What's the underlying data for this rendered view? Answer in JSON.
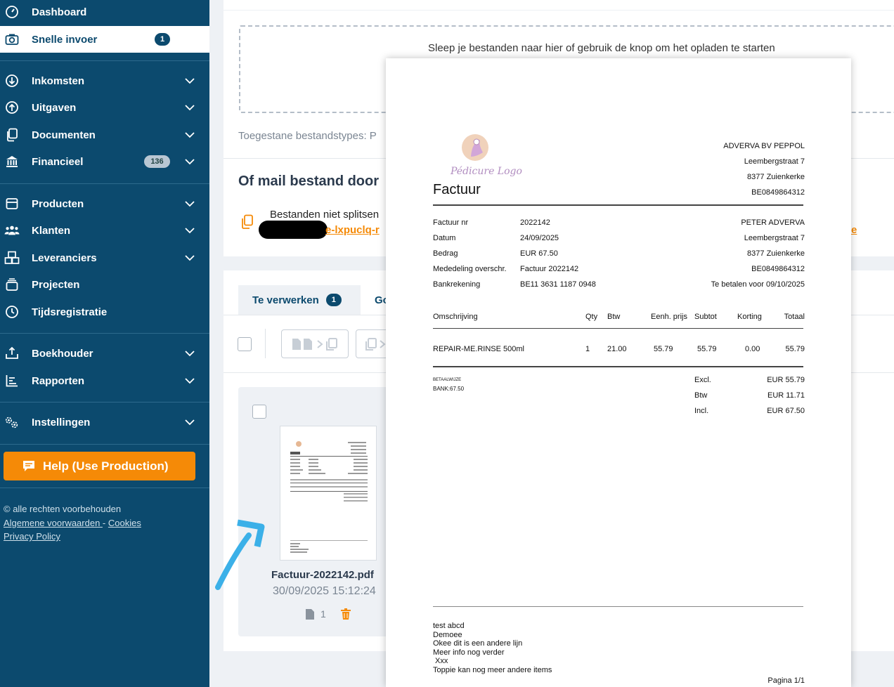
{
  "sidebar": {
    "items": [
      {
        "label": "Dashboard",
        "icon": "dashboard-icon"
      },
      {
        "label": "Snelle invoer",
        "icon": "camera-icon",
        "badge": "1"
      },
      {
        "label": "Inkomsten",
        "icon": "arrow-down-circle-icon"
      },
      {
        "label": "Uitgaven",
        "icon": "arrow-up-circle-icon"
      },
      {
        "label": "Documenten",
        "icon": "documents-icon"
      },
      {
        "label": "Financieel",
        "icon": "bank-icon",
        "badge": "136"
      },
      {
        "label": "Producten",
        "icon": "box-icon"
      },
      {
        "label": "Klanten",
        "icon": "users-icon"
      },
      {
        "label": "Leveranciers",
        "icon": "boxes-icon"
      },
      {
        "label": "Projecten",
        "icon": "stack-icon"
      },
      {
        "label": "Tijdsregistratie",
        "icon": "clock-icon"
      },
      {
        "label": "Boekhouder",
        "icon": "upload-tray-icon"
      },
      {
        "label": "Rapporten",
        "icon": "chart-icon"
      },
      {
        "label": "Instellingen",
        "icon": "gears-icon"
      }
    ],
    "help_label": "Help (Use Production)",
    "copyright": "© alle rechten voorbehouden",
    "links": {
      "terms": "Algemene voorwaarden ",
      "dash": "-",
      "cookies": "Cookies",
      "privacy": "Privacy Policy"
    }
  },
  "upload": {
    "drop_text": "Sleep je bestanden naar hier of gebruik de knop om het opladen te starten",
    "allowed_label": "Toegestane bestandstypes: P",
    "mail_title": "Of mail bestand door",
    "no_split": "Bestanden niet splitsen",
    "mail_fragment": "e-lxpuclq-r",
    "right_fragment": "e"
  },
  "tabs": {
    "to_process": "Te verwerken",
    "to_process_count": "1",
    "other": "Go"
  },
  "file": {
    "name": "Factuur-2022142.pdf",
    "date": "30/09/2025 15:12:24",
    "pages": "1"
  },
  "invoice": {
    "logo_text": "Pédicure Logo",
    "title": "Factuur",
    "seller": [
      "ADVERVA BV PEPPOL",
      "Leembergstraat 7",
      "8377 Zuienkerke",
      "BE0849864312"
    ],
    "meta_labels": [
      "Factuur nr",
      "Datum",
      "Bedrag",
      "Mededeling overschr.",
      "Bankrekening"
    ],
    "meta_values": [
      "2022142",
      "24/09/2025",
      "EUR 67.50",
      "Factuur 2022142",
      "BE11 3631 1187 0948"
    ],
    "buyer": [
      "PETER ADVERVA",
      "Leembergstraat 7",
      "8377 Zuienkerke",
      "BE0849864312",
      "Te betalen voor 09/10/2025"
    ],
    "columns": [
      "Omschrijving",
      "Qty",
      "Btw",
      "Eenh. prijs",
      "Subtot",
      "Korting",
      "Totaal"
    ],
    "line": [
      "REPAIR-ME.RINSE 500ml",
      "1",
      "21.00",
      "55.79",
      "55.79",
      "0.00",
      "55.79"
    ],
    "payment_note": [
      "BETAALWIJZE",
      "BANK:67.50"
    ],
    "totals_labels": [
      "Excl.",
      "Btw",
      "Incl."
    ],
    "totals_values": [
      "EUR 55.79",
      "EUR 11.71",
      "EUR 67.50"
    ],
    "notes": [
      "test abcd",
      "Demoee",
      "Okee dit is een andere lijn",
      "Meer info nog verder",
      " Xxx",
      "Toppie kan nog meer andere items"
    ],
    "page": "Pagina 1/1"
  },
  "colors": {
    "sidebar": "#0c4a6e",
    "accent": "#f58a07",
    "background": "#eef1f5"
  }
}
